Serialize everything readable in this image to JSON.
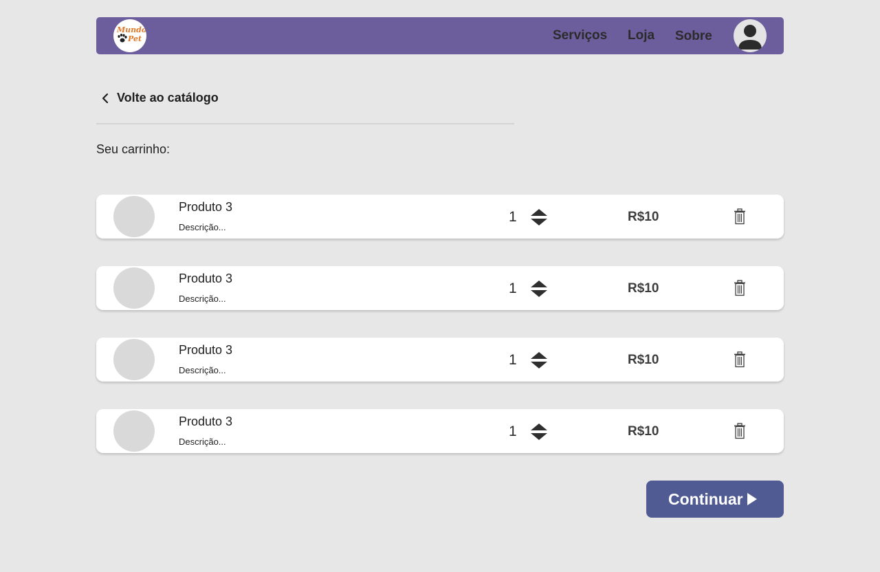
{
  "header": {
    "logo_line1": "Mundo",
    "logo_line2": "Pet",
    "nav": [
      {
        "label": "Serviços"
      },
      {
        "label": "Loja"
      },
      {
        "label": "Sobre"
      }
    ]
  },
  "back_link": {
    "label": "Volte ao catálogo"
  },
  "cart": {
    "title": "Seu carrinho:",
    "items": [
      {
        "name": "Produto 3",
        "description": "Descrição...",
        "quantity": "1",
        "price": "R$10"
      },
      {
        "name": "Produto 3",
        "description": "Descrição...",
        "quantity": "1",
        "price": "R$10"
      },
      {
        "name": "Produto 3",
        "description": "Descrição...",
        "quantity": "1",
        "price": "R$10"
      },
      {
        "name": "Produto 3",
        "description": "Descrição...",
        "quantity": "1",
        "price": "R$10"
      }
    ]
  },
  "continue_button": {
    "label": "Continuar"
  },
  "colors": {
    "background": "#e7e7e7",
    "navbar": "#6c5e9d",
    "button": "#505b94",
    "logo_text": "#e2792a"
  },
  "icons": [
    "paw-icon",
    "user-avatar-icon",
    "chevron-left-icon",
    "sort-stepper-icon",
    "trash-icon",
    "play-triangle-icon"
  ]
}
